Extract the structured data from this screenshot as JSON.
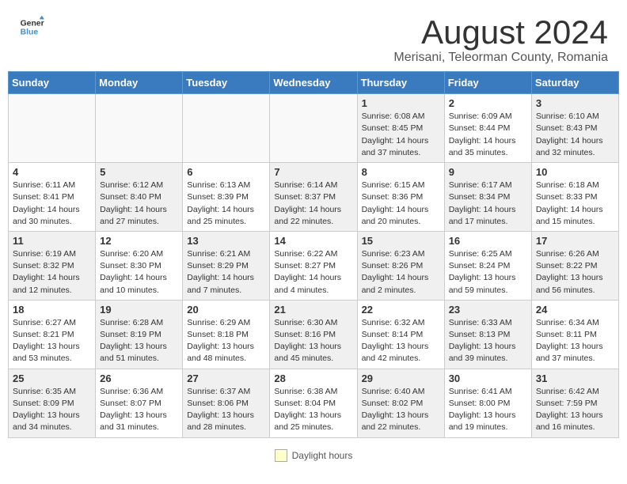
{
  "header": {
    "logo_general": "General",
    "logo_blue": "Blue",
    "month_year": "August 2024",
    "location": "Merisani, Teleorman County, Romania"
  },
  "days_of_week": [
    "Sunday",
    "Monday",
    "Tuesday",
    "Wednesday",
    "Thursday",
    "Friday",
    "Saturday"
  ],
  "weeks": [
    [
      {
        "day": "",
        "info": "",
        "empty": true
      },
      {
        "day": "",
        "info": "",
        "empty": true
      },
      {
        "day": "",
        "info": "",
        "empty": true
      },
      {
        "day": "",
        "info": "",
        "empty": true
      },
      {
        "day": "1",
        "info": "Sunrise: 6:08 AM\nSunset: 8:45 PM\nDaylight: 14 hours\nand 37 minutes.",
        "empty": false
      },
      {
        "day": "2",
        "info": "Sunrise: 6:09 AM\nSunset: 8:44 PM\nDaylight: 14 hours\nand 35 minutes.",
        "empty": false
      },
      {
        "day": "3",
        "info": "Sunrise: 6:10 AM\nSunset: 8:43 PM\nDaylight: 14 hours\nand 32 minutes.",
        "empty": false
      }
    ],
    [
      {
        "day": "4",
        "info": "Sunrise: 6:11 AM\nSunset: 8:41 PM\nDaylight: 14 hours\nand 30 minutes.",
        "empty": false
      },
      {
        "day": "5",
        "info": "Sunrise: 6:12 AM\nSunset: 8:40 PM\nDaylight: 14 hours\nand 27 minutes.",
        "empty": false
      },
      {
        "day": "6",
        "info": "Sunrise: 6:13 AM\nSunset: 8:39 PM\nDaylight: 14 hours\nand 25 minutes.",
        "empty": false
      },
      {
        "day": "7",
        "info": "Sunrise: 6:14 AM\nSunset: 8:37 PM\nDaylight: 14 hours\nand 22 minutes.",
        "empty": false
      },
      {
        "day": "8",
        "info": "Sunrise: 6:15 AM\nSunset: 8:36 PM\nDaylight: 14 hours\nand 20 minutes.",
        "empty": false
      },
      {
        "day": "9",
        "info": "Sunrise: 6:17 AM\nSunset: 8:34 PM\nDaylight: 14 hours\nand 17 minutes.",
        "empty": false
      },
      {
        "day": "10",
        "info": "Sunrise: 6:18 AM\nSunset: 8:33 PM\nDaylight: 14 hours\nand 15 minutes.",
        "empty": false
      }
    ],
    [
      {
        "day": "11",
        "info": "Sunrise: 6:19 AM\nSunset: 8:32 PM\nDaylight: 14 hours\nand 12 minutes.",
        "empty": false
      },
      {
        "day": "12",
        "info": "Sunrise: 6:20 AM\nSunset: 8:30 PM\nDaylight: 14 hours\nand 10 minutes.",
        "empty": false
      },
      {
        "day": "13",
        "info": "Sunrise: 6:21 AM\nSunset: 8:29 PM\nDaylight: 14 hours\nand 7 minutes.",
        "empty": false
      },
      {
        "day": "14",
        "info": "Sunrise: 6:22 AM\nSunset: 8:27 PM\nDaylight: 14 hours\nand 4 minutes.",
        "empty": false
      },
      {
        "day": "15",
        "info": "Sunrise: 6:23 AM\nSunset: 8:26 PM\nDaylight: 14 hours\nand 2 minutes.",
        "empty": false
      },
      {
        "day": "16",
        "info": "Sunrise: 6:25 AM\nSunset: 8:24 PM\nDaylight: 13 hours\nand 59 minutes.",
        "empty": false
      },
      {
        "day": "17",
        "info": "Sunrise: 6:26 AM\nSunset: 8:22 PM\nDaylight: 13 hours\nand 56 minutes.",
        "empty": false
      }
    ],
    [
      {
        "day": "18",
        "info": "Sunrise: 6:27 AM\nSunset: 8:21 PM\nDaylight: 13 hours\nand 53 minutes.",
        "empty": false
      },
      {
        "day": "19",
        "info": "Sunrise: 6:28 AM\nSunset: 8:19 PM\nDaylight: 13 hours\nand 51 minutes.",
        "empty": false
      },
      {
        "day": "20",
        "info": "Sunrise: 6:29 AM\nSunset: 8:18 PM\nDaylight: 13 hours\nand 48 minutes.",
        "empty": false
      },
      {
        "day": "21",
        "info": "Sunrise: 6:30 AM\nSunset: 8:16 PM\nDaylight: 13 hours\nand 45 minutes.",
        "empty": false
      },
      {
        "day": "22",
        "info": "Sunrise: 6:32 AM\nSunset: 8:14 PM\nDaylight: 13 hours\nand 42 minutes.",
        "empty": false
      },
      {
        "day": "23",
        "info": "Sunrise: 6:33 AM\nSunset: 8:13 PM\nDaylight: 13 hours\nand 39 minutes.",
        "empty": false
      },
      {
        "day": "24",
        "info": "Sunrise: 6:34 AM\nSunset: 8:11 PM\nDaylight: 13 hours\nand 37 minutes.",
        "empty": false
      }
    ],
    [
      {
        "day": "25",
        "info": "Sunrise: 6:35 AM\nSunset: 8:09 PM\nDaylight: 13 hours\nand 34 minutes.",
        "empty": false
      },
      {
        "day": "26",
        "info": "Sunrise: 6:36 AM\nSunset: 8:07 PM\nDaylight: 13 hours\nand 31 minutes.",
        "empty": false
      },
      {
        "day": "27",
        "info": "Sunrise: 6:37 AM\nSunset: 8:06 PM\nDaylight: 13 hours\nand 28 minutes.",
        "empty": false
      },
      {
        "day": "28",
        "info": "Sunrise: 6:38 AM\nSunset: 8:04 PM\nDaylight: 13 hours\nand 25 minutes.",
        "empty": false
      },
      {
        "day": "29",
        "info": "Sunrise: 6:40 AM\nSunset: 8:02 PM\nDaylight: 13 hours\nand 22 minutes.",
        "empty": false
      },
      {
        "day": "30",
        "info": "Sunrise: 6:41 AM\nSunset: 8:00 PM\nDaylight: 13 hours\nand 19 minutes.",
        "empty": false
      },
      {
        "day": "31",
        "info": "Sunrise: 6:42 AM\nSunset: 7:59 PM\nDaylight: 13 hours\nand 16 minutes.",
        "empty": false
      }
    ]
  ],
  "footer": {
    "daylight_label": "Daylight hours"
  }
}
